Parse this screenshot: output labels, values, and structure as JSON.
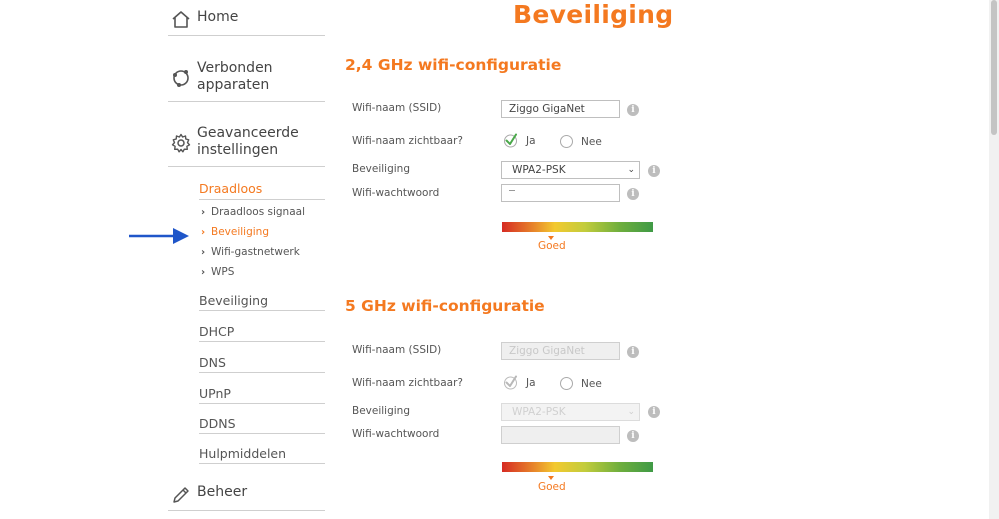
{
  "sidebar": {
    "home": "Home",
    "devices_line1": "Verbonden",
    "devices_line2": "apparaten",
    "advanced_line1": "Geavanceerde",
    "advanced_line2": "instellingen",
    "draadloos": "Draadloos",
    "draadloos_items": [
      "Draadloos signaal",
      "Beveiliging",
      "Wifi-gastnetwerk",
      "WPS"
    ],
    "beveiliging": "Beveiliging",
    "dhcp": "DHCP",
    "dns": "DNS",
    "upnp": "UPnP",
    "ddns": "DDNS",
    "hulpmiddelen": "Hulpmiddelen",
    "beheer": "Beheer"
  },
  "page": {
    "title": "Beveiliging"
  },
  "section24": {
    "title": "2,4 GHz wifi-configuratie",
    "ssid_label": "Wifi-naam (SSID)",
    "ssid_value": "Ziggo GigaNet",
    "visible_label": "Wifi-naam zichtbaar?",
    "opt_yes": "Ja",
    "opt_no": "Nee",
    "security_label": "Beveiliging",
    "security_value": "WPA2-PSK",
    "password_label": "Wifi-wachtwoord",
    "strength_label": "Goed"
  },
  "section5": {
    "title": "5 GHz wifi-configuratie",
    "ssid_label": "Wifi-naam (SSID)",
    "ssid_value": "Ziggo GigaNet",
    "visible_label": "Wifi-naam zichtbaar?",
    "opt_yes": "Ja",
    "opt_no": "Nee",
    "security_label": "Beveiliging",
    "security_value": "WPA2-PSK",
    "password_label": "Wifi-wachtwoord",
    "strength_label": "Goed"
  },
  "colors": {
    "accent": "#f47920",
    "arrow": "#1f56c9",
    "check": "#4aa84a"
  },
  "icons": [
    "home-icon",
    "devices-icon",
    "gear-icon",
    "pencil-icon",
    "info-icon",
    "check-icon",
    "chevron-right-icon",
    "arrow-right-icon"
  ]
}
